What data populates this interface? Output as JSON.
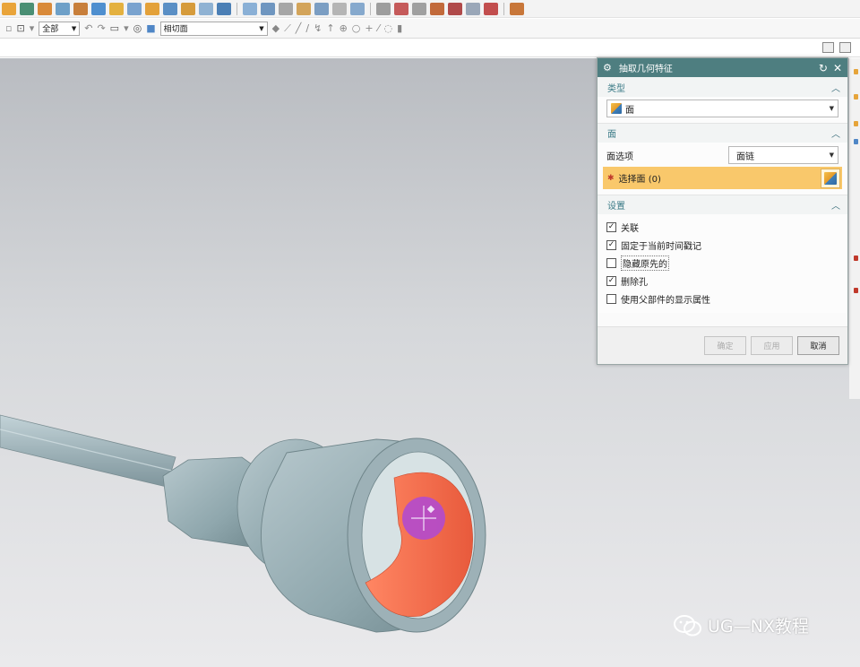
{
  "toolbar_row2": {
    "filter_select": "全部",
    "face_rule_select": "相切面"
  },
  "dialog": {
    "title": "抽取几何特征",
    "sections": {
      "type": {
        "header": "类型",
        "value": "面",
        "icon": "face-cube-icon"
      },
      "face": {
        "header": "面",
        "option_label": "面选项",
        "option_value": "面链",
        "select_label": "选择面 (0)"
      },
      "settings": {
        "header": "设置",
        "options": [
          {
            "label": "关联",
            "checked": true
          },
          {
            "label": "固定于当前时间戳记",
            "checked": true
          },
          {
            "label": "隐藏原先的",
            "checked": false
          },
          {
            "label": "删除孔",
            "checked": true
          },
          {
            "label": "使用父部件的显示属性",
            "checked": false
          }
        ]
      }
    },
    "buttons": {
      "ok": "确定",
      "apply": "应用",
      "cancel": "取消"
    }
  },
  "watermark": {
    "text": "UG—NX教程"
  },
  "colors": {
    "dialog_title_bg": "#4e7e80",
    "section_header_text": "#3a7a86",
    "selection_highlight": "#f9c86b",
    "model_body": "#8fa7ad",
    "selected_face": "#f36b4e",
    "cursor_marker": "#b14ad1"
  }
}
